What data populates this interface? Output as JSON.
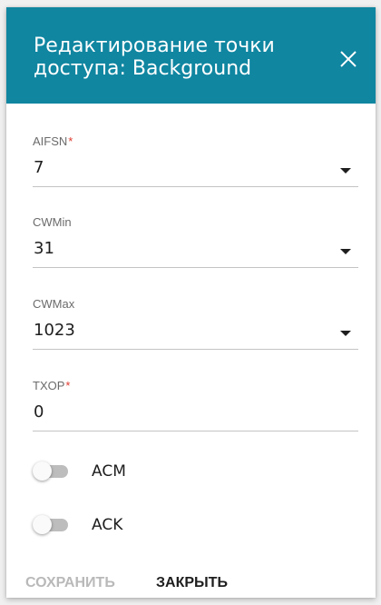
{
  "dialog": {
    "title": "Редактирование точки доступа: Background",
    "close_icon": "close-icon",
    "header_color": "#1086a1"
  },
  "fields": {
    "aifsn": {
      "label": "AIFSN",
      "required_mark": "*",
      "value": "7"
    },
    "cwmin": {
      "label": "CWMin",
      "value": "31"
    },
    "cwmax": {
      "label": "CWMax",
      "value": "1023"
    },
    "txop": {
      "label": "TXOP",
      "required_mark": "*",
      "value": "0"
    }
  },
  "toggles": {
    "acm": {
      "label": "ACM",
      "enabled": false
    },
    "ack": {
      "label": "ACK",
      "enabled": false
    }
  },
  "buttons": {
    "save_label": "СОХРАНИТЬ",
    "close_label": "ЗАКРЫТЬ"
  },
  "colors": {
    "required": "#e03a2f",
    "disabled_button": "#b9b9b9"
  }
}
